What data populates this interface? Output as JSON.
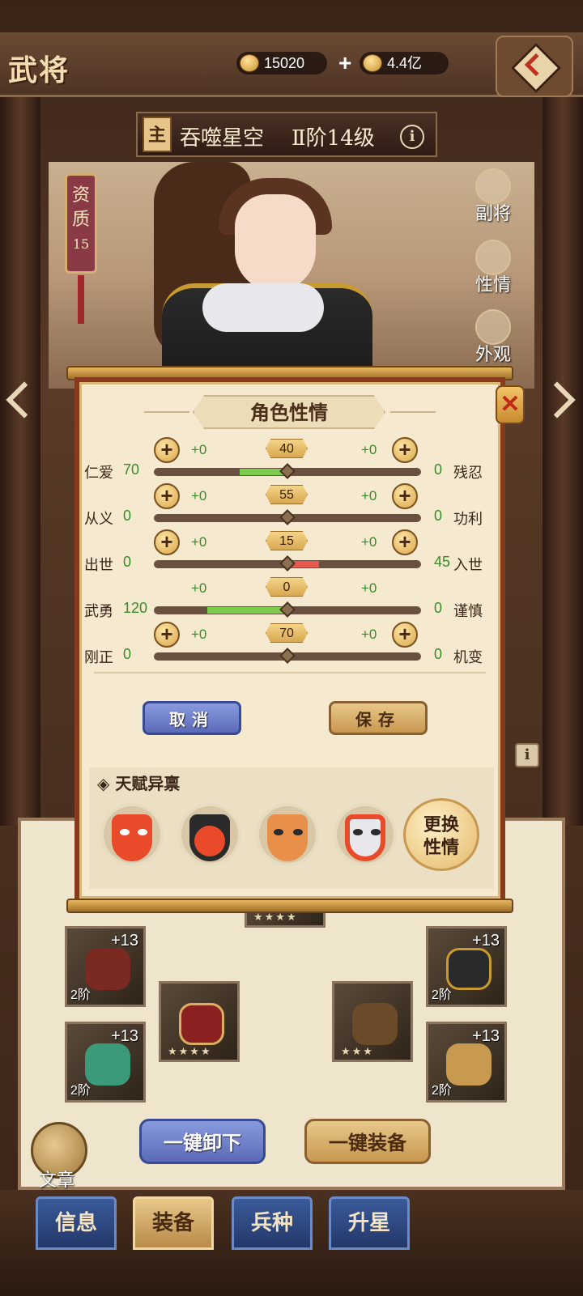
{
  "header": {
    "title": "武将",
    "currency_ingot": "15020",
    "currency_coin": "4.4亿",
    "plus": "+"
  },
  "hero": {
    "main_tag": "主",
    "name": "吞噬星空",
    "rank": "Ⅱ阶14级",
    "info": "i",
    "aptitude_label": "资质",
    "aptitude_value": "15"
  },
  "side_menu": [
    {
      "label": "副将",
      "icon": "helmet-icon"
    },
    {
      "label": "性情",
      "icon": "mask-icon"
    },
    {
      "label": "外观",
      "icon": "horse-icon"
    }
  ],
  "dialog": {
    "title": "角色性情",
    "close": "✕",
    "traits": [
      {
        "left_label": "仁爱",
        "left_value": "70",
        "right_label": "残忍",
        "right_value": "0",
        "center": "40",
        "left_delta": "+0",
        "right_delta": "+0",
        "has_plus": true,
        "position": 0.4,
        "fill_left": 0.18,
        "fill_right": 0
      },
      {
        "left_label": "从义",
        "left_value": "0",
        "right_label": "功利",
        "right_value": "0",
        "center": "55",
        "left_delta": "+0",
        "right_delta": "+0",
        "has_plus": true,
        "position": 0.4,
        "fill_left": 0,
        "fill_right": 0
      },
      {
        "left_label": "出世",
        "left_value": "0",
        "right_label": "入世",
        "right_value": "45",
        "center": "15",
        "left_delta": "+0",
        "right_delta": "+0",
        "has_plus": true,
        "position": 0.4,
        "fill_left": 0,
        "fill_right": 0.1
      },
      {
        "left_label": "武勇",
        "left_value": "120",
        "right_label": "谨慎",
        "right_value": "0",
        "center": "0",
        "left_delta": "+0",
        "right_delta": "+0",
        "has_plus": false,
        "position": 0.4,
        "fill_left": 0.3,
        "fill_right": 0
      },
      {
        "left_label": "刚正",
        "left_value": "0",
        "right_label": "机变",
        "right_value": "0",
        "center": "70",
        "left_delta": "+0",
        "right_delta": "+0",
        "has_plus": true,
        "position": 0.4,
        "fill_left": 0,
        "fill_right": 0
      }
    ],
    "cancel": "取消",
    "save": "保存",
    "talent_title": "◈ 天赋异禀",
    "change_line1": "更换",
    "change_line2": "性情"
  },
  "equipment": {
    "slots": [
      {
        "level": "+13",
        "tier": "2阶"
      },
      {
        "level": "+13",
        "tier": "2阶"
      },
      {
        "level": "+13",
        "tier": "2阶"
      },
      {
        "level": "+13",
        "tier": "2阶"
      }
    ],
    "center_stars": [
      "★★★★",
      "★★★★",
      "★★★"
    ],
    "unequip_all": "一键卸下",
    "equip_all": "一键装备",
    "emblem_label": "文章"
  },
  "tabs": [
    "信息",
    "装备",
    "兵种",
    "升星"
  ],
  "colors": {
    "accent_gold": "#d8a448",
    "positive_green": "#7ccc50",
    "negative_red": "#e8584c",
    "dialog_border": "#8a3a1c"
  }
}
